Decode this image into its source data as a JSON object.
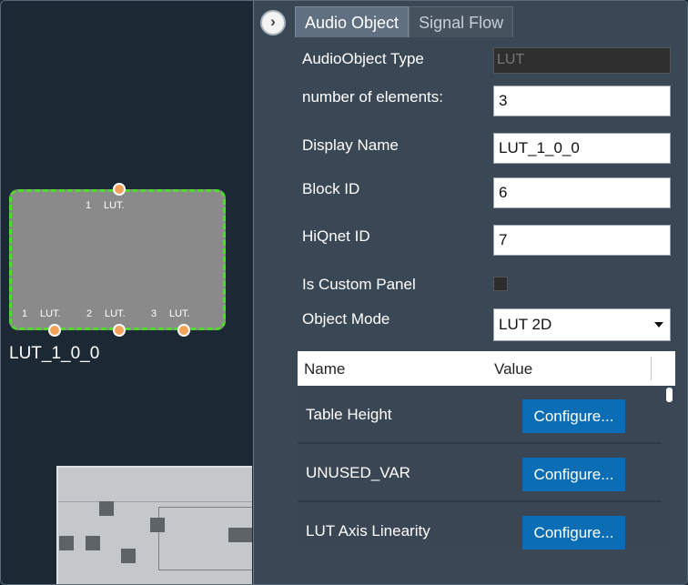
{
  "canvas": {
    "node": {
      "name": "LUT_1_0_0",
      "input_pins": [
        {
          "num": "1",
          "label": "LUT."
        }
      ],
      "output_pins": [
        {
          "num": "1",
          "label": "LUT."
        },
        {
          "num": "2",
          "label": "LUT."
        },
        {
          "num": "3",
          "label": "LUT."
        }
      ]
    }
  },
  "panel": {
    "collapse_icon": "chevron-right-icon",
    "tabs": [
      {
        "label": "Audio Object",
        "active": true
      },
      {
        "label": "Signal Flow",
        "active": false
      }
    ],
    "properties": {
      "audio_object_type": {
        "label": "AudioObject Type",
        "value": "LUT"
      },
      "number_of_elements": {
        "label": "number of elements:",
        "value": "3"
      },
      "display_name": {
        "label": "Display Name",
        "value": "LUT_1_0_0"
      },
      "block_id": {
        "label": "Block ID",
        "value": "6"
      },
      "hiqnet_id": {
        "label": "HiQnet ID",
        "value": "7"
      },
      "is_custom_panel": {
        "label": "Is Custom Panel",
        "checked": false
      },
      "object_mode": {
        "label": "Object Mode",
        "value": "LUT 2D"
      }
    },
    "grid": {
      "headers": [
        "Name",
        "Value"
      ],
      "rows": [
        {
          "name": "Table Height",
          "button": "Configure..."
        },
        {
          "name": "UNUSED_VAR",
          "button": "Configure..."
        },
        {
          "name": "LUT Axis Linearity",
          "button": "Configure..."
        }
      ]
    }
  },
  "colors": {
    "accent_button": "#0a6db5",
    "selection_border": "#4fdc2a",
    "port": "#f2a25a"
  }
}
